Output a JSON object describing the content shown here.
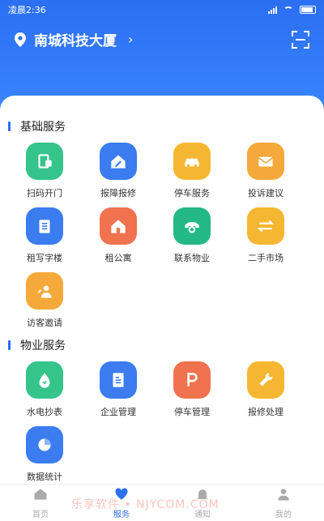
{
  "status_bar": {
    "time": "凌晨2:36"
  },
  "location": {
    "name": "南城科技大厦",
    "arrow": "›"
  },
  "sections": [
    {
      "title": "基础服务",
      "items": [
        {
          "label": "扫码开门",
          "icon": "door-scan-icon",
          "color": "#35c48a"
        },
        {
          "label": "报障报修",
          "icon": "house-repair-icon",
          "color": "#3b7cf0"
        },
        {
          "label": "停车服务",
          "icon": "car-icon",
          "color": "#f5b731"
        },
        {
          "label": "投诉建议",
          "icon": "mail-icon",
          "color": "#f5a93a"
        },
        {
          "label": "租写字楼",
          "icon": "building-icon",
          "color": "#3b7cf0"
        },
        {
          "label": "租公寓",
          "icon": "home-icon",
          "color": "#f0724f"
        },
        {
          "label": "联系物业",
          "icon": "phone-icon",
          "color": "#23b886"
        },
        {
          "label": "二手市场",
          "icon": "exchange-icon",
          "color": "#f5b731"
        },
        {
          "label": "访客邀请",
          "icon": "visitor-icon",
          "color": "#f5a93a"
        }
      ]
    },
    {
      "title": "物业服务",
      "items": [
        {
          "label": "水电抄表",
          "icon": "water-drop-icon",
          "color": "#35c48a"
        },
        {
          "label": "企业管理",
          "icon": "document-icon",
          "color": "#3b7cf0"
        },
        {
          "label": "停车管理",
          "icon": "parking-icon",
          "color": "#f0724f"
        },
        {
          "label": "报修处理",
          "icon": "wrench-icon",
          "color": "#f5b731"
        },
        {
          "label": "数据统计",
          "icon": "pie-chart-icon",
          "color": "#3b7cf0"
        }
      ]
    }
  ],
  "tabbar": [
    {
      "label": "首页",
      "icon": "home-tab-icon",
      "active": false
    },
    {
      "label": "服务",
      "icon": "heart-tab-icon",
      "active": true
    },
    {
      "label": "通知",
      "icon": "bell-tab-icon",
      "active": false
    },
    {
      "label": "我的",
      "icon": "user-tab-icon",
      "active": false
    }
  ],
  "watermark": "乐享软件 • NJYCOM.COM"
}
